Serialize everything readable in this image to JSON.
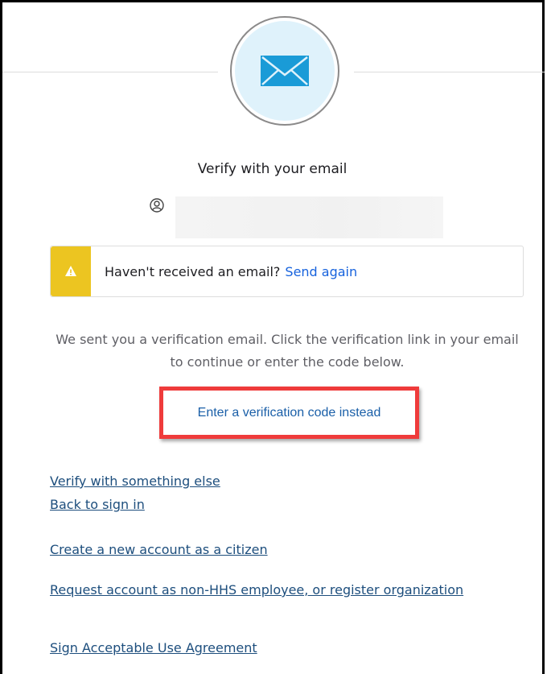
{
  "header": {
    "title": "Verify with your email"
  },
  "icons": {
    "factor": "envelope-icon",
    "user": "user-circle-icon",
    "warning": "warning-icon"
  },
  "user": {
    "identifier": ""
  },
  "callout": {
    "text": "Haven't received an email?",
    "link": "Send again"
  },
  "description": "We sent you a verification email. Click the verification link in your email to continue or enter the code below.",
  "actions": {
    "enter_code": "Enter a verification code instead"
  },
  "links": {
    "verify_else": "Verify with something else",
    "back_signin": "Back to sign in",
    "create_citizen": "Create a new account as a citizen",
    "request_account": "Request account as non-HHS employee, or register organization",
    "sign_agreement": "Sign Acceptable Use Agreement"
  },
  "colors": {
    "warning": "#ecc521",
    "link": "#1662dd",
    "highlight_border": "#ef3b3b",
    "envelope": "#1a9bd7",
    "circle_fill": "#dff2fb"
  }
}
